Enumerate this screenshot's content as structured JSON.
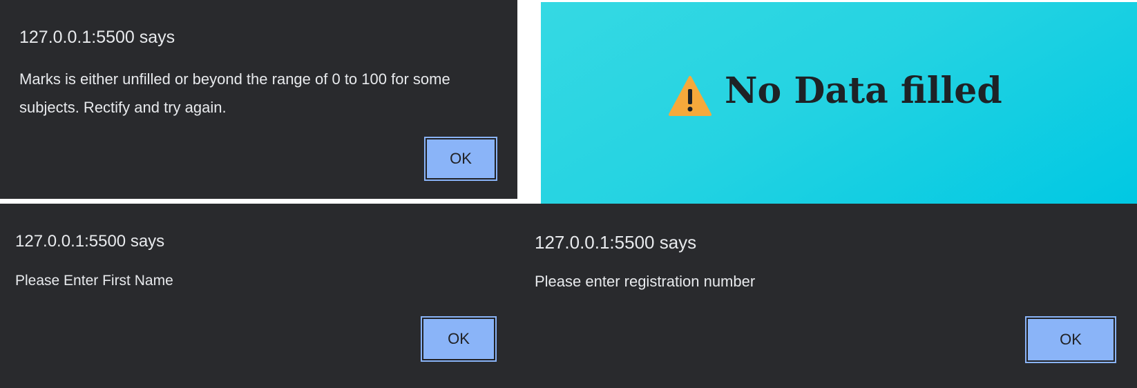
{
  "dialogs": [
    {
      "title": "127.0.0.1:5500 says",
      "message": "Marks is either unfilled or beyond the range of 0 to 100 for some subjects. Rectify and try again.",
      "ok_label": "OK"
    },
    {
      "title": "127.0.0.1:5500 says",
      "message": "Please Enter First Name",
      "ok_label": "OK"
    },
    {
      "title": "127.0.0.1:5500 says",
      "message": "Please enter registration number",
      "ok_label": "OK"
    }
  ],
  "toast": {
    "icon": "warning-icon",
    "text": "No Data filled"
  },
  "colors": {
    "dialog_bg": "#292a2d",
    "dialog_text": "#e8eaed",
    "button_bg": "#8ab4f8",
    "toast_bg": "#25d3e2",
    "warning_icon": "#f6a93b"
  }
}
